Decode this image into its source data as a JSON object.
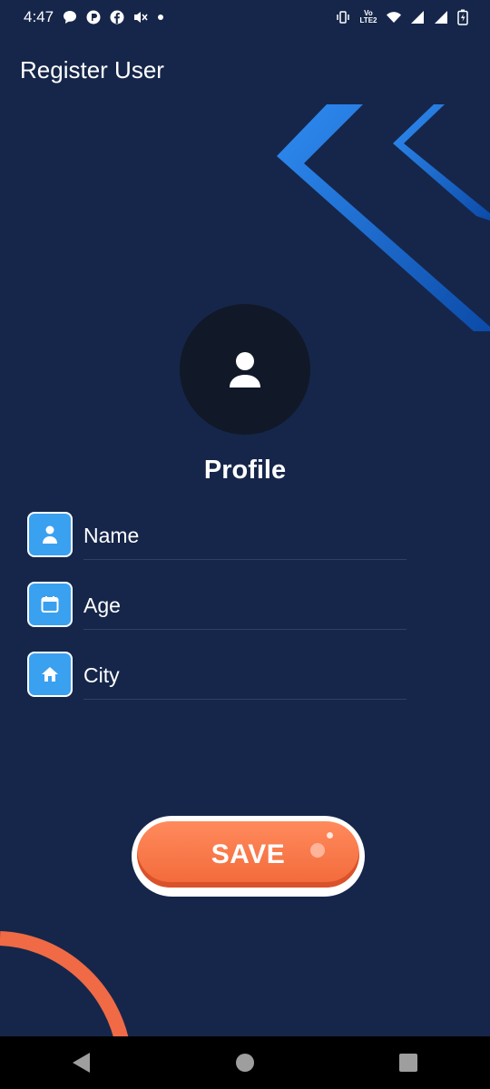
{
  "status_bar": {
    "time": "4:47",
    "left_icons": [
      "message-icon",
      "app-icon",
      "facebook-icon",
      "volume-muted-icon",
      "dot-icon"
    ],
    "right_icons": [
      "vibrate-icon",
      "volte-icon",
      "wifi-icon",
      "signal-icon",
      "signal-icon",
      "battery-icon"
    ],
    "volte_label": "Vo LTE2"
  },
  "app_bar": {
    "title": "Register User"
  },
  "profile": {
    "title": "Profile",
    "avatar_icon": "person-icon"
  },
  "form": {
    "fields": [
      {
        "placeholder": "Name",
        "icon": "person-icon",
        "value": ""
      },
      {
        "placeholder": "Age",
        "icon": "calendar-icon",
        "value": ""
      },
      {
        "placeholder": "City",
        "icon": "home-icon",
        "value": ""
      }
    ]
  },
  "save_button": {
    "label": "SAVE"
  },
  "nav_bar": {
    "buttons": [
      "back-icon",
      "home-circle-icon",
      "recents-icon"
    ]
  },
  "colors": {
    "background": "#16264a",
    "accent_blue": "#3aa0f0",
    "save_orange": "#f2693a",
    "avatar_bg": "#111827"
  }
}
